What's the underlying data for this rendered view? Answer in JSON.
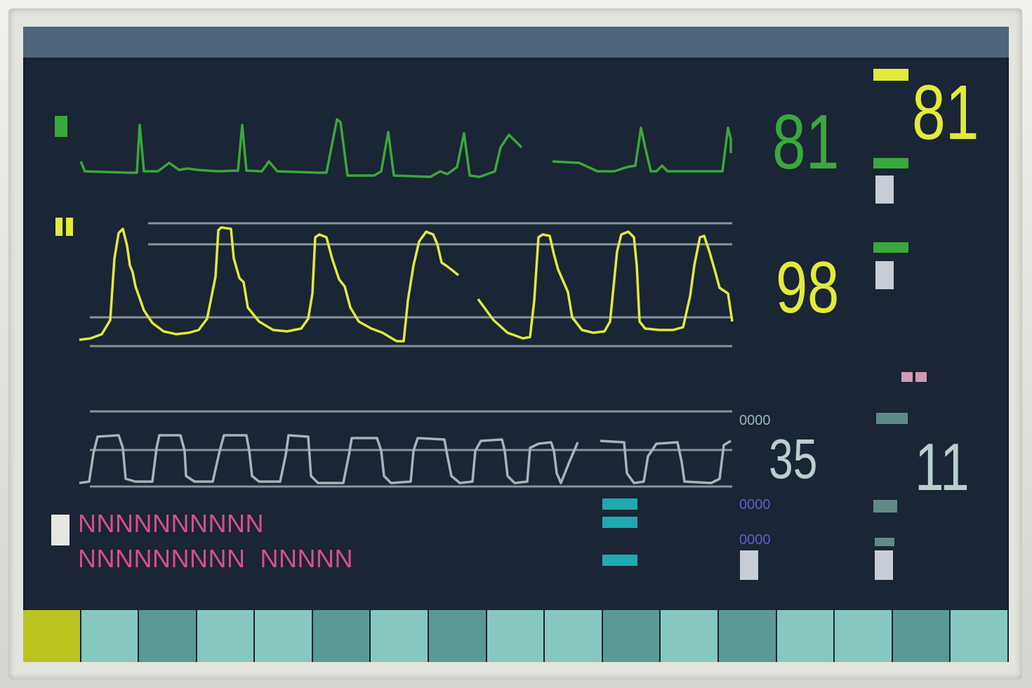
{
  "monitor": {
    "ecg": {
      "hr_value": "81",
      "color": "#3aa83a"
    },
    "pleth": {
      "spo2_value": "98",
      "color": "#e2ea3a"
    },
    "resp": {
      "value": "35",
      "color": "#b8d0cc"
    },
    "right_panel": {
      "top_value": "81",
      "top_color": "#e2ea3a",
      "bottom_value": "11",
      "bottom_color": "#b8d0cc"
    },
    "small_labels": [
      {
        "text": "0000",
        "color": "#9ab8b8"
      },
      {
        "text": "0000",
        "color": "#5a63c8"
      },
      {
        "text": "0000",
        "color": "#5a63c8"
      }
    ],
    "alarm_lines": [
      "NNNNNNNNNN",
      "NNNNNNNNN  NNNNN"
    ],
    "alarm_color": "#d6508a",
    "softkey_colors": [
      "#b9c420",
      "#86c8c0",
      "#5a9a94",
      "#86c8c0",
      "#86c8c0",
      "#5a9a94",
      "#86c8c0",
      "#5a9a94",
      "#86c8c0",
      "#86c8c0",
      "#5a9a94",
      "#86c8c0",
      "#5a9a94",
      "#86c8c0",
      "#86c8c0",
      "#5a9a94",
      "#86c8c0"
    ]
  }
}
